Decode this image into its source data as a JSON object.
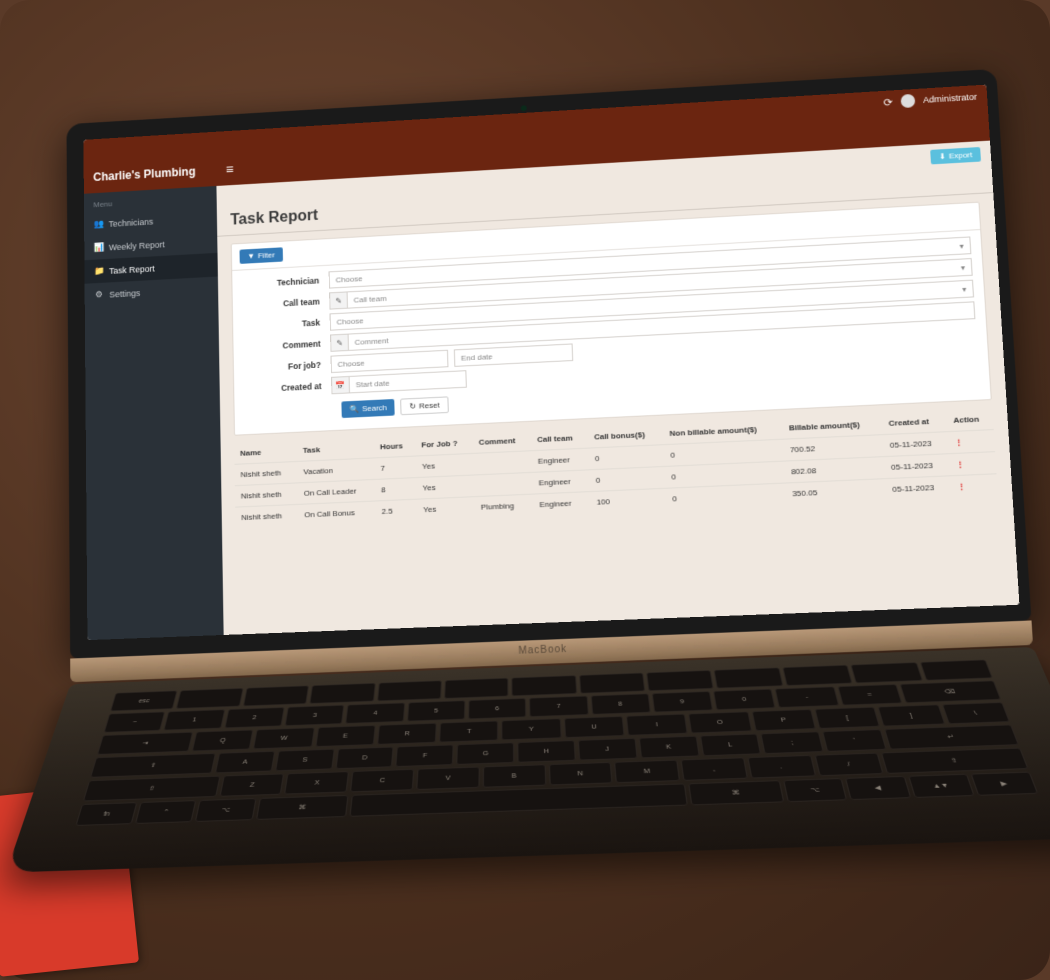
{
  "topbar": {
    "user_label": "Administrator"
  },
  "brand": "Charlie's Plumbing",
  "sidebar": {
    "menu_header": "Menu",
    "items": [
      {
        "icon": "users-icon",
        "glyph": "👥",
        "label": "Technicians"
      },
      {
        "icon": "report-icon",
        "glyph": "📊",
        "label": "Weekly Report"
      },
      {
        "icon": "folder-icon",
        "glyph": "📁",
        "label": "Task Report"
      },
      {
        "icon": "gear-icon",
        "glyph": "⚙",
        "label": "Settings"
      }
    ]
  },
  "export_button": "Export",
  "page_title": "Task Report",
  "filter_button": "Filter",
  "form": {
    "technician": {
      "label": "Technician",
      "placeholder": "Choose"
    },
    "call_team": {
      "label": "Call team",
      "placeholder": "Call team"
    },
    "task": {
      "label": "Task",
      "placeholder": "Choose"
    },
    "comment": {
      "label": "Comment",
      "placeholder": "Comment"
    },
    "for_job": {
      "label": "For job?",
      "placeholder": "Choose",
      "end_placeholder": "End date"
    },
    "created_at": {
      "label": "Created at",
      "placeholder": "Start date"
    },
    "search_btn": "Search",
    "reset_btn": "Reset"
  },
  "table": {
    "headers": {
      "name": "Name",
      "task": "Task",
      "hours": "Hours",
      "for_job": "For Job ?",
      "comment": "Comment",
      "call_team": "Call team",
      "call_bonus": "Call bonus($)",
      "non_billable": "Non billable amount($)",
      "billable": "Billable amount($)",
      "created_at": "Created at",
      "action": "Action"
    },
    "rows": [
      {
        "name": "Nishit sheth",
        "task": "Vacation",
        "hours": "7",
        "for_job": "Yes",
        "comment": "",
        "call_team": "Engineer",
        "call_bonus": "0",
        "non_billable": "0",
        "billable": "700.52",
        "created_at": "05-11-2023"
      },
      {
        "name": "Nishit sheth",
        "task": "On Call Leader",
        "hours": "8",
        "for_job": "Yes",
        "comment": "",
        "call_team": "Engineer",
        "call_bonus": "0",
        "non_billable": "0",
        "billable": "802.08",
        "created_at": "05-11-2023"
      },
      {
        "name": "Nishit sheth",
        "task": "On Call Bonus",
        "hours": "2.5",
        "for_job": "Yes",
        "comment": "Plumbing",
        "call_team": "Engineer",
        "call_bonus": "100",
        "non_billable": "0",
        "billable": "350.05",
        "created_at": "05-11-2023"
      }
    ]
  },
  "laptop_brand": "MacBook"
}
